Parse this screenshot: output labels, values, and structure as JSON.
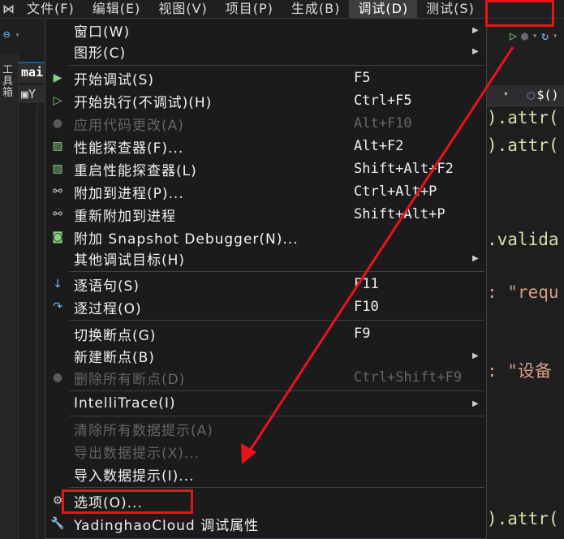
{
  "menubar": {
    "items": [
      {
        "label": "文件(F)"
      },
      {
        "label": "编辑(E)"
      },
      {
        "label": "视图(V)"
      },
      {
        "label": "项目(P)"
      },
      {
        "label": "生成(B)"
      },
      {
        "label": "调试(D)"
      },
      {
        "label": "测试(S)"
      }
    ]
  },
  "sidebar": {
    "label": "工具箱"
  },
  "tab": {
    "label": "mai"
  },
  "file_row": {
    "label": "Y"
  },
  "editor_header": {
    "selector": "$()"
  },
  "code_lines": [
    {
      "text": ").attr("
    },
    {
      "text": ").attr("
    },
    {
      "text": ".valida"
    },
    {
      "text": ": \"requ"
    },
    {
      "text": ": \"设备"
    },
    {
      "text": ").attr("
    }
  ],
  "debug_menu": {
    "items": [
      {
        "label": "窗口(W)",
        "shortcut": "",
        "state": "enabled",
        "icon": "",
        "submenu": true
      },
      {
        "label": "图形(C)",
        "shortcut": "",
        "state": "enabled",
        "icon": "",
        "submenu": true
      },
      {
        "label": "开始调试(S)",
        "shortcut": "F5",
        "state": "enabled",
        "icon": "play-filled-icon"
      },
      {
        "label": "开始执行(不调试)(H)",
        "shortcut": "Ctrl+F5",
        "state": "enabled",
        "icon": "play-outline-icon"
      },
      {
        "label": "应用代码更改(A)",
        "shortcut": "Alt+F10",
        "state": "disabled",
        "icon": "hot-reload-icon"
      },
      {
        "label": "性能探查器(F)...",
        "shortcut": "Alt+F2",
        "state": "enabled",
        "icon": "profiler-icon"
      },
      {
        "label": "重启性能探查器(L)",
        "shortcut": "Shift+Alt+F2",
        "state": "enabled",
        "icon": "profiler-restart-icon"
      },
      {
        "label": "附加到进程(P)...",
        "shortcut": "Ctrl+Alt+P",
        "state": "enabled",
        "icon": "attach-process-icon"
      },
      {
        "label": "重新附加到进程",
        "shortcut": "Shift+Alt+P",
        "state": "enabled",
        "icon": "reattach-process-icon"
      },
      {
        "label": "附加 Snapshot Debugger(N)...",
        "shortcut": "",
        "state": "enabled",
        "icon": "snapshot-icon"
      },
      {
        "label": "其他调试目标(H)",
        "shortcut": "",
        "state": "enabled",
        "icon": "",
        "submenu": true
      },
      {
        "label": "逐语句(S)",
        "shortcut": "F11",
        "state": "enabled",
        "icon": "step-into-icon"
      },
      {
        "label": "逐过程(O)",
        "shortcut": "F10",
        "state": "enabled",
        "icon": "step-over-icon"
      },
      {
        "label": "切换断点(G)",
        "shortcut": "F9",
        "state": "enabled",
        "icon": ""
      },
      {
        "label": "新建断点(B)",
        "shortcut": "",
        "state": "enabled",
        "icon": "",
        "submenu": true
      },
      {
        "label": "删除所有断点(D)",
        "shortcut": "Ctrl+Shift+F9",
        "state": "disabled",
        "icon": "delete-breakpoints-icon"
      },
      {
        "label": "IntelliTrace(I)",
        "shortcut": "",
        "state": "enabled",
        "icon": "",
        "submenu": true
      },
      {
        "label": "清除所有数据提示(A)",
        "shortcut": "",
        "state": "disabled",
        "icon": ""
      },
      {
        "label": "导出数据提示(X)...",
        "shortcut": "",
        "state": "disabled",
        "icon": ""
      },
      {
        "label": "导入数据提示(I)...",
        "shortcut": "",
        "state": "enabled",
        "icon": ""
      },
      {
        "label": "选项(O)...",
        "shortcut": "",
        "state": "enabled",
        "icon": "gear-icon"
      },
      {
        "label": "YadinghaoCloud 调试属性",
        "shortcut": "",
        "state": "enabled",
        "icon": "wrench-icon"
      }
    ]
  },
  "colors": {
    "annotation": "#e8141c",
    "menu_bg": "#1b1b1c",
    "disabled_text": "#656565"
  }
}
